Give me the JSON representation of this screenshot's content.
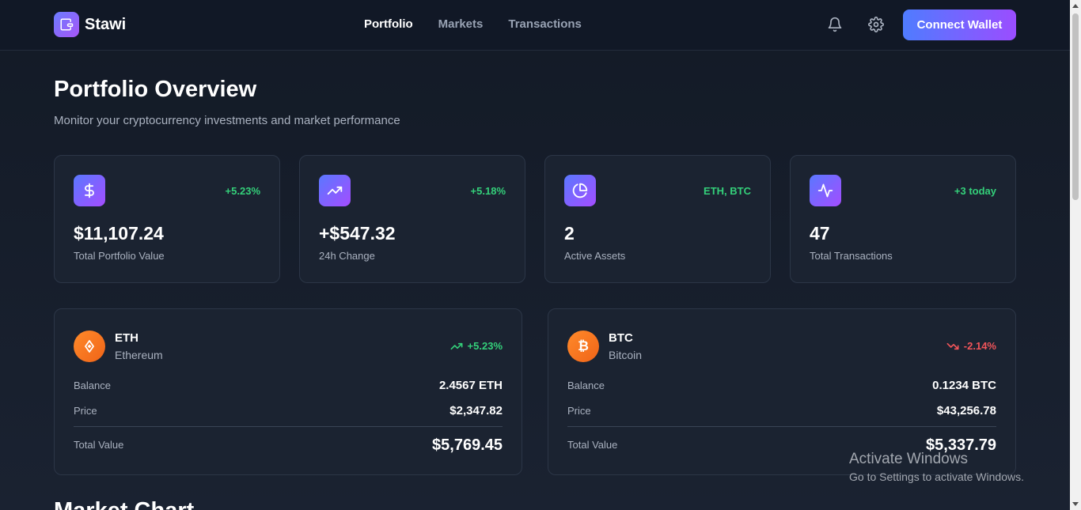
{
  "header": {
    "brand": "Stawi",
    "nav": [
      {
        "label": "Portfolio",
        "active": true
      },
      {
        "label": "Markets",
        "active": false
      },
      {
        "label": "Transactions",
        "active": false
      }
    ],
    "connect_label": "Connect Wallet"
  },
  "page": {
    "title": "Portfolio Overview",
    "subtitle": "Monitor your cryptocurrency investments and market performance",
    "next_section": "Market Chart"
  },
  "stats": [
    {
      "icon": "dollar-icon",
      "badge": "+5.23%",
      "value": "$11,107.24",
      "label": "Total Portfolio Value"
    },
    {
      "icon": "trending-up-icon",
      "badge": "+5.18%",
      "value": "+$547.32",
      "label": "24h Change"
    },
    {
      "icon": "pie-chart-icon",
      "badge": "ETH, BTC",
      "value": "2",
      "label": "Active Assets"
    },
    {
      "icon": "activity-icon",
      "badge": "+3 today",
      "value": "47",
      "label": "Total Transactions"
    }
  ],
  "assets": [
    {
      "symbol": "ETH",
      "name": "Ethereum",
      "change": "+5.23%",
      "direction": "up",
      "balance_label": "Balance",
      "balance": "2.4567 ETH",
      "price_label": "Price",
      "price": "$2,347.82",
      "total_label": "Total Value",
      "total": "$5,769.45"
    },
    {
      "symbol": "BTC",
      "name": "Bitcoin",
      "change": "-2.14%",
      "direction": "down",
      "balance_label": "Balance",
      "balance": "0.1234 BTC",
      "price_label": "Price",
      "price": "$43,256.78",
      "total_label": "Total Value",
      "total": "$5,337.79"
    }
  ],
  "watermark": {
    "title": "Activate Windows",
    "subtitle": "Go to Settings to activate Windows."
  },
  "colors": {
    "positive": "#34d07a",
    "negative": "#f2555a",
    "accent_start": "#4f7cff",
    "accent_end": "#9b4dff",
    "coin": "#f47a20"
  }
}
